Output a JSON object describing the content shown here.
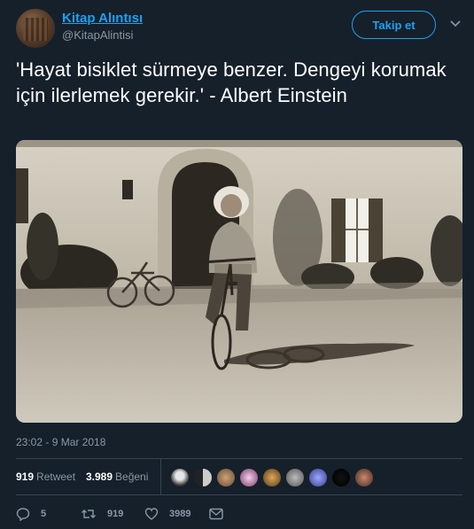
{
  "user": {
    "name": "Kitap Alıntısı",
    "handle": "@KitapAlintisi",
    "follow_label": "Takip et"
  },
  "tweet": {
    "text": "'Hayat bisiklet sürmeye benzer. Dengeyi korumak için ilerlemek gerekir.' - Albert Einstein",
    "timestamp": "23:02 - 9 Mar 2018"
  },
  "stats": {
    "retweet_count": "919",
    "retweet_label": "Retweet",
    "like_count": "3.989",
    "like_label": "Beğeni"
  },
  "actions": {
    "reply_count": "5",
    "retweet_count": "919",
    "like_count": "3989"
  },
  "icons": {
    "caret": "chevron-down-icon",
    "reply": "reply-icon",
    "retweet": "retweet-icon",
    "like": "heart-icon",
    "message": "envelope-icon"
  },
  "colors": {
    "background": "#15202b",
    "accent": "#1da1f2",
    "secondary_text": "#8899a6",
    "divider": "#38444d"
  },
  "likers_count_shown": 10
}
